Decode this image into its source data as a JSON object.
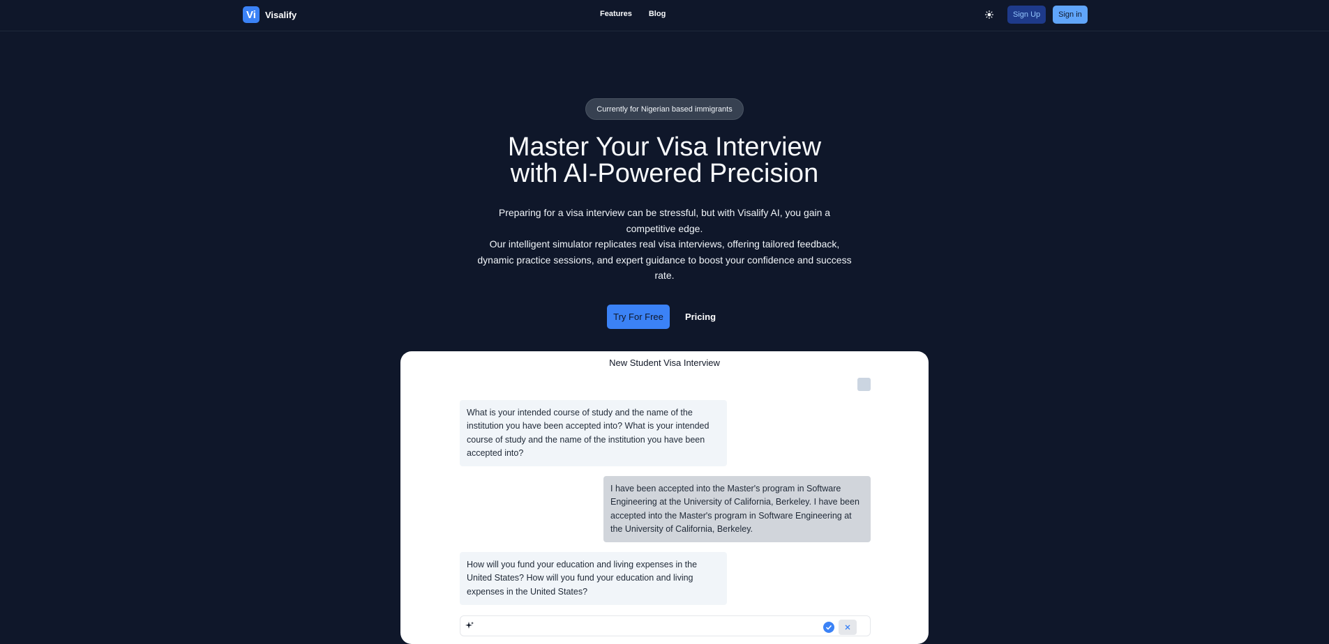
{
  "nav": {
    "logo_text": "Vi",
    "brand": "Visalify",
    "links": [
      {
        "label": "Features"
      },
      {
        "label": "Blog"
      }
    ],
    "theme_icon": "sun-icon",
    "signup_label": "Sign Up",
    "signin_label": "Sign in"
  },
  "hero": {
    "badge": "Currently for Nigerian based immigrants",
    "headline_line1": "Master Your Visa Interview",
    "headline_line2": "with AI-Powered Precision",
    "subtext_1": "Preparing for a visa interview can be stressful, but with Visalify AI, you gain a competitive edge.",
    "subtext_2": "Our intelligent simulator replicates real visa interviews, offering tailored feedback, dynamic practice sessions, and expert guidance to boost your confidence and success rate.",
    "cta_primary": "Try For Free",
    "cta_secondary": "Pricing"
  },
  "chat": {
    "title": "New Student Visa Interview",
    "messages": [
      {
        "role": "interviewer",
        "text": "What is your intended course of study and the name of the institution you have been accepted into? What is your intended course of study and the name of the institution you have been accepted into?"
      },
      {
        "role": "applicant",
        "text": "I have been accepted into the Master's program in Software Engineering at the University of California, Berkeley. I have been accepted into the Master's program in Software Engineering at the University of California, Berkeley."
      },
      {
        "role": "interviewer",
        "text": "How will you fund your education and living expenses in the United States? How will you fund your education and living expenses in the United States?"
      }
    ],
    "input_icon": "sparkle-icon",
    "confirm_icon": "check-icon",
    "close_icon": "close-icon"
  },
  "colors": {
    "background": "#0f172a",
    "accent": "#3b82f6"
  }
}
